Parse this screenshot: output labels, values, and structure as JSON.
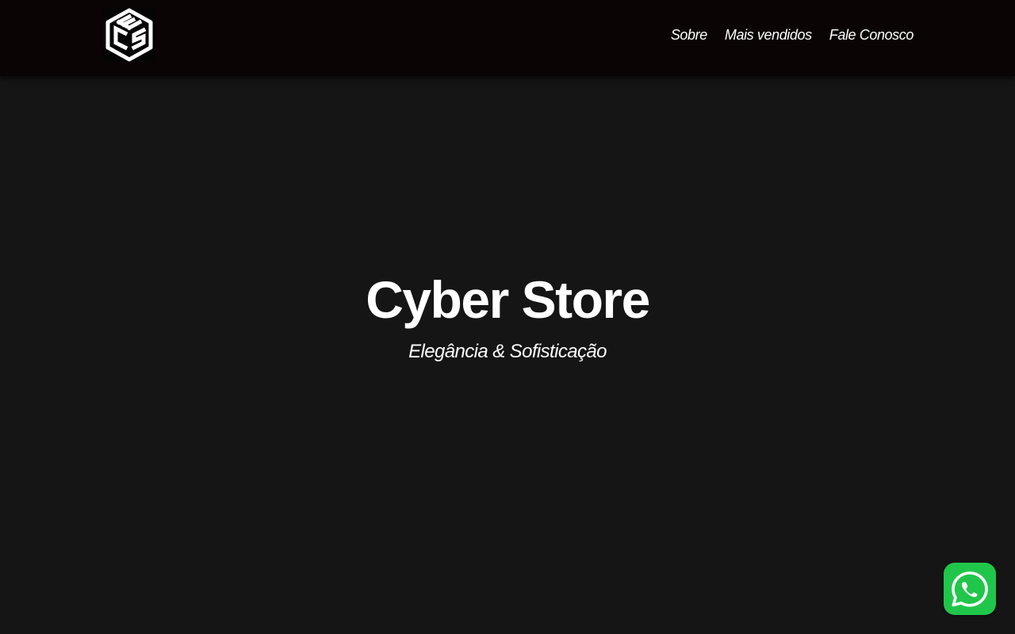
{
  "header": {
    "logo_icon": "cube-fcs-logo-icon",
    "nav": [
      {
        "label": "Sobre"
      },
      {
        "label": "Mais vendidos"
      },
      {
        "label": "Fale Conosco"
      }
    ]
  },
  "hero": {
    "title": "Cyber Store",
    "subtitle": "Elegância & Sofisticação"
  },
  "floating": {
    "whatsapp_icon": "whatsapp-icon",
    "whatsapp_color": "#20c64a"
  },
  "colors": {
    "header_bg": "#0a0405",
    "page_bg": "#151515",
    "text": "#ffffff"
  }
}
